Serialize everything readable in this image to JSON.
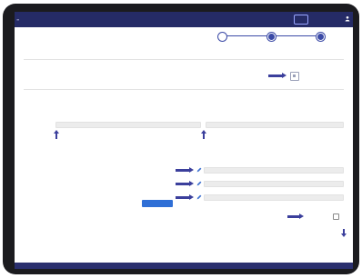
{
  "header": {
    "logo_text": "",
    "user_icon": "user-icon",
    "logo_icon": "brand-logo-icon"
  },
  "stepper": {
    "steps": [
      {
        "label": "",
        "active": false
      },
      {
        "label": "",
        "active": true
      },
      {
        "label": "",
        "active": false
      }
    ]
  },
  "page": {
    "title": "",
    "subtitle": ""
  },
  "sections": {
    "upload_label": "",
    "basic_info_label": "",
    "contact_label": ""
  },
  "fields": {
    "field1_label": "",
    "field2_label": "",
    "field3_label": "",
    "field4_label": "",
    "field5_label": "",
    "field6_label": "",
    "field7_label": ""
  },
  "actions": {
    "primary_button": "",
    "checkbox_label": "",
    "bottom_link": ""
  },
  "footer": {
    "text": ""
  },
  "colors": {
    "header_bg": "#252b66",
    "accent": "#3b3f9c",
    "button": "#2f6fd6",
    "field_bg": "#ececec"
  }
}
